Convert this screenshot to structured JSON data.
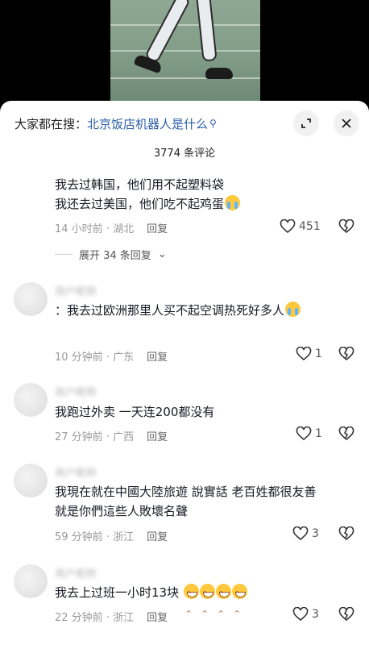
{
  "search": {
    "prefix": "大家都在搜：",
    "query": "北京饭店机器人是什么"
  },
  "icons": {
    "search": "magnifier-icon",
    "expand": "fullscreen-icon",
    "close": "close-icon",
    "like": "heart-icon",
    "dislike": "broken-heart-icon"
  },
  "comment_count_label": "3774 条评论",
  "comments": [
    {
      "text_line1": "我去过韩国，他们用不起塑料袋",
      "text_line2": "我还去过美国，他们吃不起鸡蛋",
      "time": "14 小时前",
      "location": "湖北",
      "reply_label": "回复",
      "likes": "451",
      "expand_label": "展开 34 条回复"
    },
    {
      "text": "：我去过欧洲那里人买不起空调热死好多人",
      "time": "10 分钟前",
      "location": "广东",
      "reply_label": "回复",
      "likes": "1"
    },
    {
      "text": "我跑过外卖 一天连200都没有",
      "time": "27 分钟前",
      "location": "广西",
      "reply_label": "回复",
      "likes": "1"
    },
    {
      "text_line1": "我現在就在中國大陸旅遊 說實話 老百姓都很友善",
      "text_line2": "就是你們這些人敗壞名聲",
      "time": "59 分钟前",
      "location": "浙江",
      "reply_label": "回复",
      "likes": "3"
    },
    {
      "text": "我去上过班一小时13块",
      "time": "22 分钟前",
      "location": "浙江",
      "reply_label": "回复",
      "likes": "3"
    }
  ],
  "colors": {
    "link": "#2c5fa8",
    "meta": "#9a9a9a",
    "text": "#161823"
  }
}
